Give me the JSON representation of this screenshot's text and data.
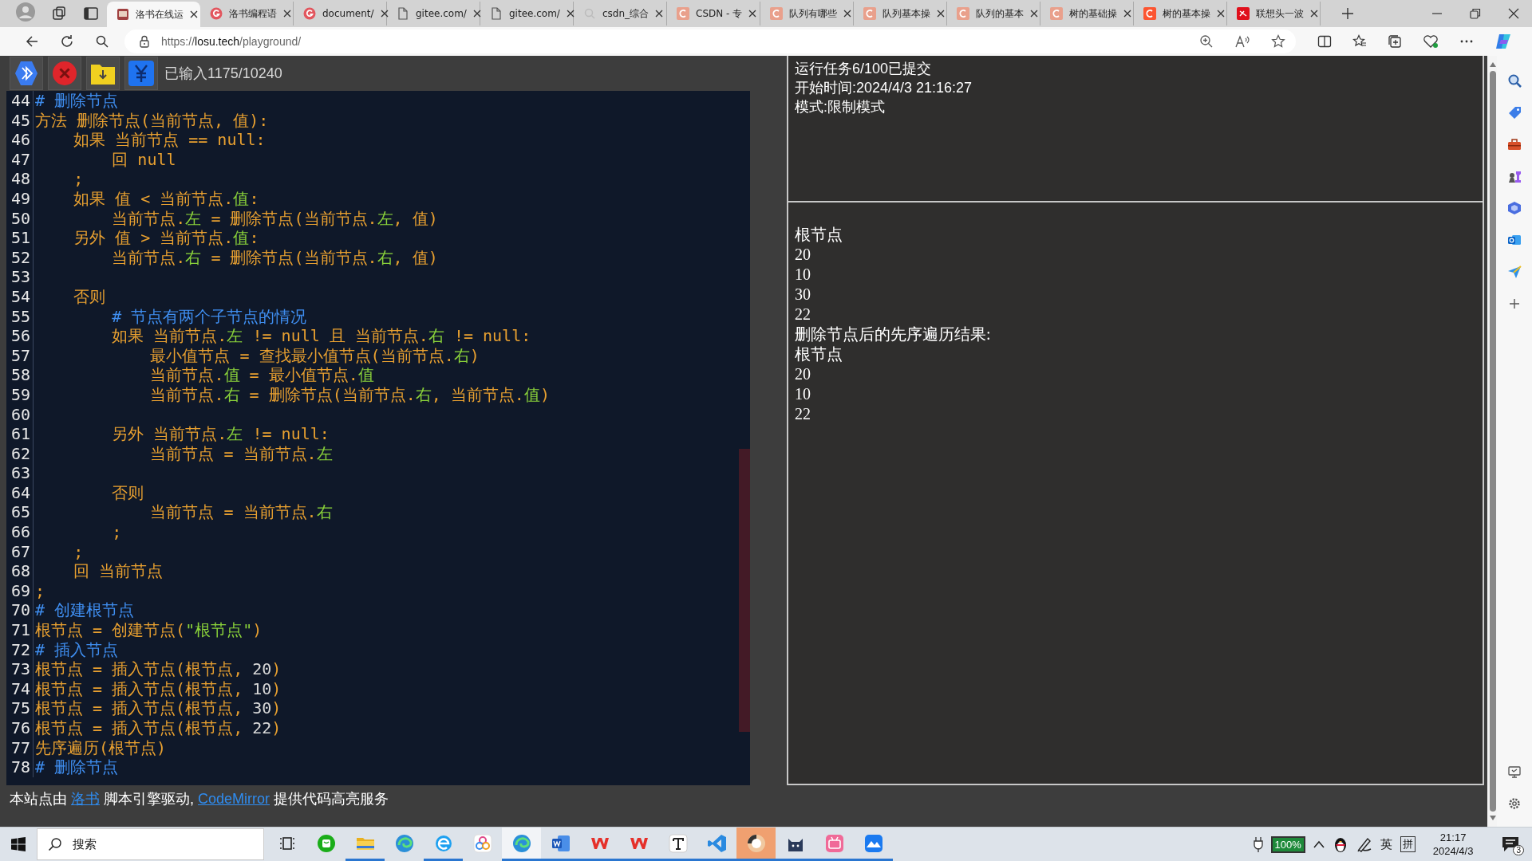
{
  "browser": {
    "tabs": [
      {
        "title": "洛书在线运",
        "kind": "image",
        "selected": true
      },
      {
        "title": "洛书编程语",
        "kind": "circle",
        "selected": false
      },
      {
        "title": "document/",
        "kind": "circle",
        "selected": false
      },
      {
        "title": "gitee.com/",
        "kind": "page",
        "selected": false
      },
      {
        "title": "gitee.com/",
        "kind": "page",
        "selected": false
      },
      {
        "title": "csdn_综合",
        "kind": "search",
        "selected": false
      },
      {
        "title": "CSDN - 专",
        "kind": "square",
        "selected": false
      },
      {
        "title": "队列有哪些",
        "kind": "square",
        "selected": false
      },
      {
        "title": "队列基本操",
        "kind": "square",
        "selected": false
      },
      {
        "title": "队列的基本",
        "kind": "square",
        "selected": false
      },
      {
        "title": "树的基础操",
        "kind": "square",
        "selected": false
      },
      {
        "title": "树的基本操",
        "kind": "bright",
        "selected": false
      },
      {
        "title": "联想头一波",
        "kind": "red",
        "selected": false
      }
    ],
    "url_scheme": "https://",
    "url_host": "losu.tech",
    "url_path": "/playground/"
  },
  "toolbar": {
    "counter": "已输入1175/10240"
  },
  "editor": {
    "lines": [
      {
        "number": "44",
        "tokens": [
          {
            "kind": "comment",
            "text": "# 删除节点"
          }
        ]
      },
      {
        "number": "45",
        "tokens": [
          {
            "kind": "code",
            "text": "方法 删除节点(当前节点, 值):"
          }
        ]
      },
      {
        "number": "46",
        "tokens": [
          {
            "kind": "code",
            "text": "    如果 当前节点 == null:"
          }
        ]
      },
      {
        "number": "47",
        "tokens": [
          {
            "kind": "code",
            "text": "        回 null"
          }
        ]
      },
      {
        "number": "48",
        "tokens": [
          {
            "kind": "code",
            "text": "    ;"
          }
        ]
      },
      {
        "number": "49",
        "tokens": [
          {
            "kind": "code",
            "text": "    如果 值 < 当前节点."
          },
          {
            "kind": "property",
            "text": "值"
          },
          {
            "kind": "code",
            "text": ":"
          }
        ]
      },
      {
        "number": "50",
        "tokens": [
          {
            "kind": "code",
            "text": "        当前节点."
          },
          {
            "kind": "property",
            "text": "左"
          },
          {
            "kind": "code",
            "text": " = 删除节点(当前节点."
          },
          {
            "kind": "property",
            "text": "左"
          },
          {
            "kind": "code",
            "text": ", 值)"
          }
        ]
      },
      {
        "number": "51",
        "tokens": [
          {
            "kind": "code",
            "text": "    另外 值 > 当前节点."
          },
          {
            "kind": "property",
            "text": "值"
          },
          {
            "kind": "code",
            "text": ":"
          }
        ]
      },
      {
        "number": "52",
        "tokens": [
          {
            "kind": "code",
            "text": "        当前节点."
          },
          {
            "kind": "property",
            "text": "右"
          },
          {
            "kind": "code",
            "text": " = 删除节点(当前节点."
          },
          {
            "kind": "property",
            "text": "右"
          },
          {
            "kind": "code",
            "text": ", 值)"
          }
        ]
      },
      {
        "number": "53"
      },
      {
        "number": "54",
        "tokens": [
          {
            "kind": "code",
            "text": "    否则"
          }
        ]
      },
      {
        "number": "55",
        "tokens": [
          {
            "kind": "comment",
            "text": "        # 节点有两个子节点的情况"
          }
        ]
      },
      {
        "number": "56",
        "tokens": [
          {
            "kind": "code",
            "text": "        如果 当前节点."
          },
          {
            "kind": "property",
            "text": "左"
          },
          {
            "kind": "code",
            "text": " != null 且 当前节点."
          },
          {
            "kind": "property",
            "text": "右"
          },
          {
            "kind": "code",
            "text": " != null:"
          }
        ]
      },
      {
        "number": "57",
        "tokens": [
          {
            "kind": "code",
            "text": "            最小值节点 = 查找最小值节点(当前节点."
          },
          {
            "kind": "property",
            "text": "右"
          },
          {
            "kind": "code",
            "text": ")"
          }
        ]
      },
      {
        "number": "58",
        "tokens": [
          {
            "kind": "code",
            "text": "            当前节点."
          },
          {
            "kind": "property",
            "text": "值"
          },
          {
            "kind": "code",
            "text": " = 最小值节点."
          },
          {
            "kind": "property",
            "text": "值"
          }
        ]
      },
      {
        "number": "59",
        "tokens": [
          {
            "kind": "code",
            "text": "            当前节点."
          },
          {
            "kind": "property",
            "text": "右"
          },
          {
            "kind": "code",
            "text": " = 删除节点(当前节点."
          },
          {
            "kind": "property",
            "text": "右"
          },
          {
            "kind": "code",
            "text": ", 当前节点."
          },
          {
            "kind": "property",
            "text": "值"
          },
          {
            "kind": "code",
            "text": ")"
          }
        ]
      },
      {
        "number": "60"
      },
      {
        "number": "61",
        "tokens": [
          {
            "kind": "code",
            "text": "        另外 当前节点."
          },
          {
            "kind": "property",
            "text": "左"
          },
          {
            "kind": "code",
            "text": " != null:"
          }
        ]
      },
      {
        "number": "62",
        "tokens": [
          {
            "kind": "code",
            "text": "            当前节点 = 当前节点."
          },
          {
            "kind": "property",
            "text": "左"
          }
        ]
      },
      {
        "number": "63"
      },
      {
        "number": "64",
        "tokens": [
          {
            "kind": "code",
            "text": "        否则"
          }
        ]
      },
      {
        "number": "65",
        "tokens": [
          {
            "kind": "code",
            "text": "            当前节点 = 当前节点."
          },
          {
            "kind": "property",
            "text": "右"
          }
        ]
      },
      {
        "number": "66",
        "tokens": [
          {
            "kind": "code",
            "text": "        ;"
          }
        ]
      },
      {
        "number": "67",
        "tokens": [
          {
            "kind": "code",
            "text": "    ;"
          }
        ]
      },
      {
        "number": "68",
        "tokens": [
          {
            "kind": "code",
            "text": "    回 当前节点"
          }
        ]
      },
      {
        "number": "69",
        "tokens": [
          {
            "kind": "code",
            "text": ";"
          }
        ]
      },
      {
        "number": "70",
        "tokens": [
          {
            "kind": "comment",
            "text": "# 创建根节点"
          }
        ]
      },
      {
        "number": "71",
        "tokens": [
          {
            "kind": "code",
            "text": "根节点 = 创建节点("
          },
          {
            "kind": "string",
            "text": "\"根节点\""
          },
          {
            "kind": "code",
            "text": ")"
          }
        ]
      },
      {
        "number": "72",
        "tokens": [
          {
            "kind": "comment",
            "text": "# 插入节点"
          }
        ]
      },
      {
        "number": "73",
        "tokens": [
          {
            "kind": "code",
            "text": "根节点 = 插入节点(根节点, "
          },
          {
            "kind": "number",
            "text": "20"
          },
          {
            "kind": "code",
            "text": ")"
          }
        ]
      },
      {
        "number": "74",
        "tokens": [
          {
            "kind": "code",
            "text": "根节点 = 插入节点(根节点, "
          },
          {
            "kind": "number",
            "text": "10"
          },
          {
            "kind": "code",
            "text": ")"
          }
        ]
      },
      {
        "number": "75",
        "tokens": [
          {
            "kind": "code",
            "text": "根节点 = 插入节点(根节点, "
          },
          {
            "kind": "number",
            "text": "30"
          },
          {
            "kind": "code",
            "text": ")"
          }
        ]
      },
      {
        "number": "76",
        "tokens": [
          {
            "kind": "code",
            "text": "根节点 = 插入节点(根节点, "
          },
          {
            "kind": "number",
            "text": "22"
          },
          {
            "kind": "code",
            "text": ")"
          }
        ]
      },
      {
        "number": "77",
        "tokens": [
          {
            "kind": "code",
            "text": "先序遍历(根节点)"
          }
        ]
      },
      {
        "number": "78",
        "tokens": [
          {
            "kind": "comment",
            "text": "# 删除节点"
          }
        ]
      }
    ]
  },
  "output": {
    "status": [
      "运行任务6/100已提交",
      "开始时间:2024/4/3 21:16:27",
      "模式:限制模式"
    ],
    "lines": [
      "根节点",
      "20",
      "10",
      "30",
      "22",
      "删除节点后的先序遍历结果:",
      "根节点",
      "20",
      "10",
      "22"
    ]
  },
  "footer": {
    "parts": [
      {
        "kind": "text",
        "text": "本站点由"
      },
      {
        "kind": "link",
        "text": "洛书"
      },
      {
        "kind": "text",
        "text": "脚本引擎驱动,"
      },
      {
        "kind": "link",
        "text": "CodeMirror"
      },
      {
        "kind": "text",
        "text": "提供代码高亮服务"
      }
    ]
  },
  "taskbar": {
    "search_placeholder": "搜索",
    "apps": [
      {
        "kind": "taskview",
        "running": false,
        "selected": false
      },
      {
        "kind": "chat",
        "running": false,
        "selected": false
      },
      {
        "kind": "folder",
        "running": true,
        "selected": false
      },
      {
        "kind": "swirl",
        "running": false,
        "selected": false
      },
      {
        "kind": "e",
        "running": true,
        "selected": false
      },
      {
        "kind": "dots",
        "running": false,
        "selected": false
      },
      {
        "kind": "swirl",
        "running": true,
        "selected": true
      },
      {
        "kind": "word",
        "running": true,
        "selected": false
      },
      {
        "kind": "wps",
        "running": true,
        "selected": false
      },
      {
        "kind": "wps",
        "running": true,
        "selected": false
      },
      {
        "kind": "t",
        "running": true,
        "selected": false
      },
      {
        "kind": "vscode",
        "running": true,
        "selected": false
      },
      {
        "kind": "orange",
        "running": true,
        "selected": true
      },
      {
        "kind": "cat",
        "running": true,
        "selected": false
      },
      {
        "kind": "tv",
        "running": true,
        "selected": false
      },
      {
        "kind": "mountain",
        "running": true,
        "selected": false
      }
    ],
    "battery": "100%",
    "ime_language": "英",
    "ime_mode": "拼",
    "time": "21:17",
    "date": "2024/4/3",
    "notifications": "3"
  }
}
